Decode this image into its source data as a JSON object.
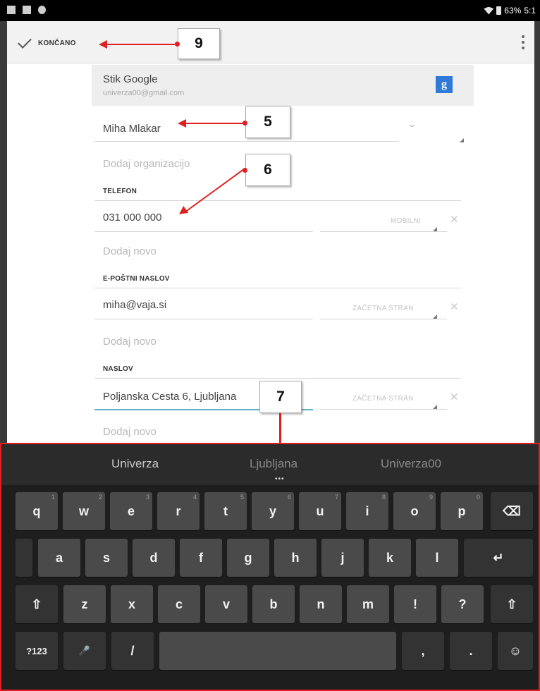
{
  "status_bar": {
    "battery": "63%",
    "time": "5:1"
  },
  "action_bar": {
    "done_label": "KONČANO",
    "overflow_icon": "more-vert-icon"
  },
  "account": {
    "name": "Stik Google",
    "email": "univerza00@gmail.com",
    "icon": "g"
  },
  "form": {
    "name_value": "Miha Mlakar",
    "organization_hint": "Dodaj organizacijo",
    "phone_section": "TELEFON",
    "phone_value": "031 000 000",
    "phone_type": "MOBILNI",
    "add_phone_hint": "Dodaj novo",
    "email_section": "E-POŠTNI NASLOV",
    "email_value": "miha@vaja.si",
    "email_type": "ZAČETNA STRAN",
    "add_email_hint": "Dodaj novo",
    "address_section": "NASLOV",
    "address_value": "Poljanska Cesta 6, Ljubljana",
    "address_type": "ZAČETNA STRAN",
    "add_address_hint": "Dodaj novo"
  },
  "callouts": {
    "c9": "9",
    "c5": "5",
    "c6": "6",
    "c7": "7"
  },
  "keyboard": {
    "suggestions": [
      "Univerza",
      "Ljubljana",
      "Univerza00"
    ],
    "row1": [
      [
        "q",
        "1"
      ],
      [
        "w",
        "2"
      ],
      [
        "e",
        "3"
      ],
      [
        "r",
        "4"
      ],
      [
        "t",
        "5"
      ],
      [
        "y",
        "6"
      ],
      [
        "u",
        "7"
      ],
      [
        "i",
        "8"
      ],
      [
        "o",
        "9"
      ],
      [
        "p",
        "0"
      ]
    ],
    "row2": [
      "a",
      "s",
      "d",
      "f",
      "g",
      "h",
      "j",
      "k",
      "l"
    ],
    "row3": [
      "z",
      "x",
      "c",
      "v",
      "b",
      "n",
      "m",
      "!",
      "?"
    ],
    "symbols_key": "?123",
    "slash_key": "/",
    "comma_key": ",",
    "period_key": ".",
    "backspace_icon": "backspace-icon",
    "enter_icon": "enter-icon",
    "shift_icon": "shift-icon",
    "mic_icon": "mic-icon",
    "emoji_icon": "emoji-icon"
  },
  "colors": {
    "callout_arrow": "#e02020",
    "active_underline": "#5fb0c8",
    "keyboard_bg": "#1e1e1e",
    "key_bg": "#4a4a4a"
  }
}
